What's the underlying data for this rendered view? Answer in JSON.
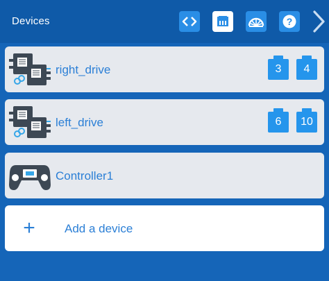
{
  "header": {
    "title": "Devices",
    "buttons": [
      {
        "icon": "code-brackets-icon",
        "active": false
      },
      {
        "icon": "ethernet-port-icon",
        "active": true
      },
      {
        "icon": "dashboard-gauge-icon",
        "active": false
      },
      {
        "icon": "help-icon",
        "active": false
      }
    ],
    "next_icon": "chevron-right-icon"
  },
  "devices": [
    {
      "name": "right_drive",
      "icon": "motor-group-icon",
      "ports": [
        "3",
        "4"
      ]
    },
    {
      "name": "left_drive",
      "icon": "motor-group-icon",
      "ports": [
        "6",
        "10"
      ]
    },
    {
      "name": "Controller1",
      "icon": "controller-icon",
      "ports": []
    }
  ],
  "add_device": {
    "icon": "plus-icon",
    "label": "Add a device"
  },
  "colors": {
    "header_bg": "#0f5aa8",
    "page_bg": "#1565b8",
    "accent": "#2595ec",
    "text_accent": "#2b7fd6",
    "card_bg": "#e6e9ee"
  }
}
